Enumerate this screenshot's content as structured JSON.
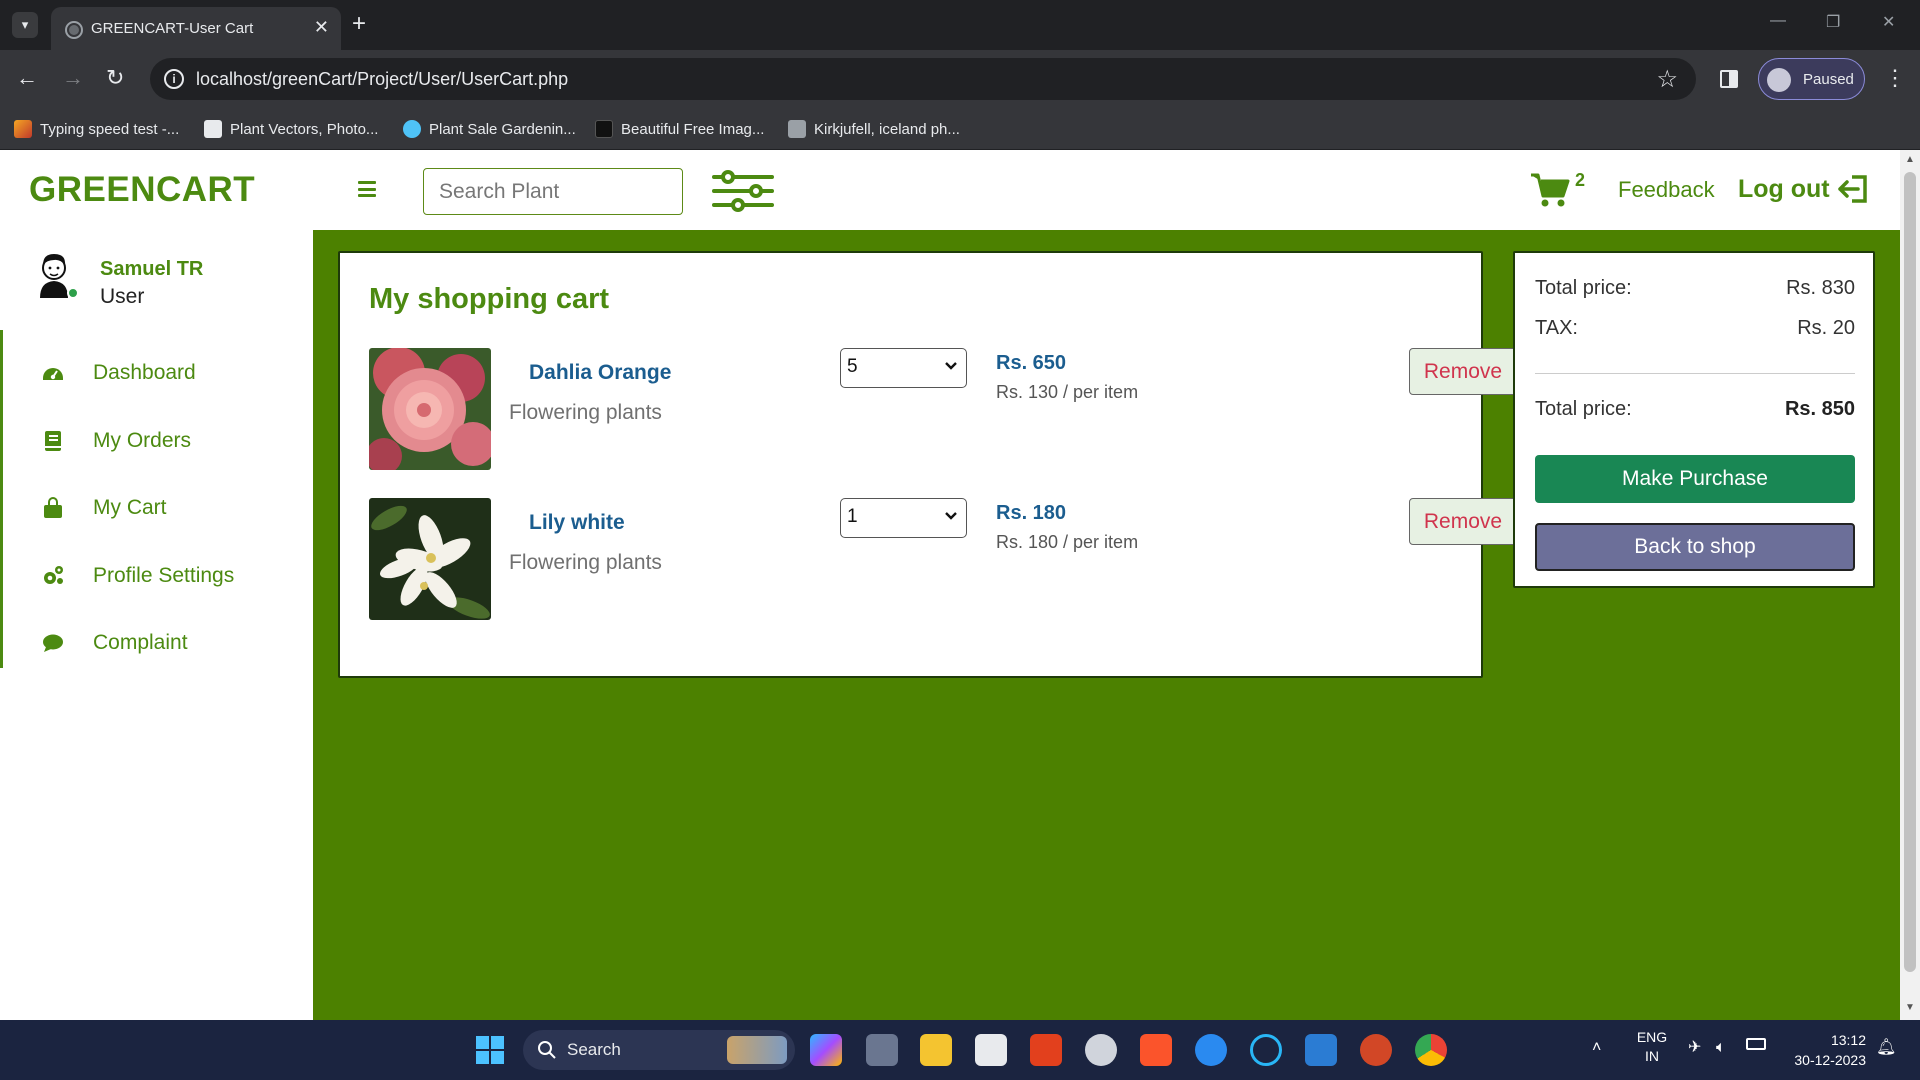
{
  "browser": {
    "tab_title": "GREENCART-User Cart",
    "url": "localhost/greenCart/Project/User/UserCart.php",
    "profile_label": "Paused",
    "bookmarks": [
      {
        "label": "Typing speed test -...",
        "color": "#f5a623"
      },
      {
        "label": "Plant Vectors, Photo...",
        "color": "#e8eaed"
      },
      {
        "label": "Plant Sale Gardenin...",
        "color": "#4fc3f7"
      },
      {
        "label": "Beautiful Free Imag...",
        "color": "#111111"
      },
      {
        "label": "Kirkjufell, iceland ph...",
        "color": "#9aa0a6"
      }
    ]
  },
  "header": {
    "logo": "GREENCART",
    "search_placeholder": "Search Plant",
    "cart_count": "2",
    "feedback_label": "Feedback",
    "logout_label": "Log out"
  },
  "sidebar": {
    "user_name": "Samuel TR",
    "user_role": "User",
    "items": [
      {
        "label": "Dashboard",
        "icon": "gauge-icon"
      },
      {
        "label": "My Orders",
        "icon": "book-icon"
      },
      {
        "label": "My Cart",
        "icon": "bag-icon"
      },
      {
        "label": "Profile Settings",
        "icon": "gears-icon"
      },
      {
        "label": "Complaint",
        "icon": "chat-icon"
      }
    ]
  },
  "cart": {
    "title": "My shopping cart",
    "items": [
      {
        "name": "Dahlia Orange",
        "category": "Flowering plants",
        "quantity": "5",
        "price": "Rs. 650",
        "per_item": "Rs. 130 / per item",
        "remove_label": "Remove"
      },
      {
        "name": "Lily white",
        "category": "Flowering plants",
        "quantity": "1",
        "price": "Rs. 180",
        "per_item": "Rs. 180 / per item",
        "remove_label": "Remove"
      }
    ]
  },
  "summary": {
    "total_label": "Total price:",
    "total_value": "Rs. 830",
    "tax_label": "TAX:",
    "tax_value": "Rs. 20",
    "grand_label": "Total price:",
    "grand_value": "Rs. 850",
    "purchase_label": "Make Purchase",
    "back_label": "Back to shop"
  },
  "taskbar": {
    "search_label": "Search",
    "lang_line1": "ENG",
    "lang_line2": "IN",
    "time": "13:12",
    "date": "30-12-2023"
  },
  "colors": {
    "brand_green": "#4c8a11",
    "main_bg": "#4c8100",
    "purchase_button": "#198754",
    "back_button": "#6c6f99",
    "remove_text": "#d0344d",
    "product_name": "#1b5d8f"
  }
}
